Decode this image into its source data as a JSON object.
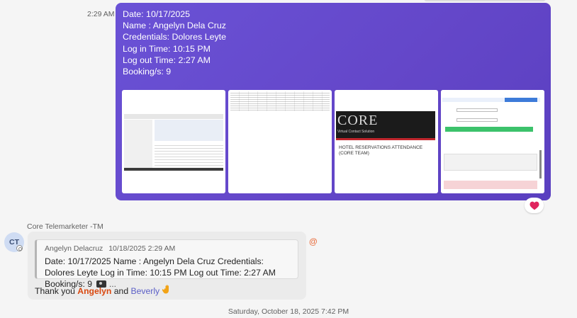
{
  "first_message": {
    "time": "2:29 AM",
    "lines": [
      "Date: 10/17/2025",
      "Name : Angelyn Dela Cruz",
      "Credentials: Dolores Leyte",
      "Log in Time: 10:15 PM",
      "Log out Time: 2:27 AM",
      "Booking/s: 9"
    ],
    "bubble_color": "#6447c9",
    "attachments": {
      "core_logo_text": "CORE",
      "core_subtitle": "Virtual Contact Solution",
      "core_title": "HOTEL RESERVATIONS ATTENDANCE (CORE TEAM)"
    },
    "reaction": "heart-icon"
  },
  "second_message": {
    "sender": "Core Telemarketer -TM",
    "avatar_initials": "CT",
    "quote": {
      "author": "Angelyn Delacruz",
      "timestamp": "10/18/2025 2:29 AM",
      "text": "Date: 10/17/2025 Name : Angelyn Dela Cruz Credentials: Dolores Leyte Log in Time: 10:15 PM Log out Time: 2:27 AM Booking/s: 9",
      "ellipsis": "..."
    },
    "reply": {
      "prefix": "Thank you ",
      "mention1": "Angelyn",
      "middle": " and ",
      "mention2": "Beverly"
    },
    "mention_icon": "@"
  },
  "date_divider": "Saturday, October 18, 2025 7:42 PM",
  "colors": {
    "purple": "#6447c9",
    "mention_orange": "#d9480f",
    "mention_blue": "#5b5fc7",
    "heart": "#e0245e"
  }
}
